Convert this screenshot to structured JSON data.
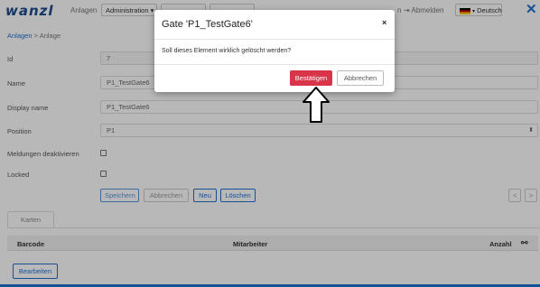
{
  "nav": {
    "logo": "wanzl",
    "anlagen": "Anlagen",
    "administration": "Administration ▾",
    "hidden_items": [
      "Einstellungen",
      "Hilfe"
    ],
    "logout_icon": "logout-icon",
    "logout": "Abmelden",
    "language": "Deutsch",
    "user_partial": "n"
  },
  "breadcrumb": {
    "root": "Anlagen",
    "sep": ">",
    "current": "Anlage"
  },
  "form": {
    "id_label": "Id",
    "id_value": "7",
    "name_label": "Name",
    "name_value": "P1_TestGate6",
    "display_label": "Display name",
    "display_value": "P1_TestGate6",
    "position_label": "Position",
    "position_value": "P1",
    "meldungen_label": "Meldungen deaktivieren",
    "locked_label": "Locked"
  },
  "actions": {
    "save": "Speichern",
    "cancel": "Abbrechen",
    "new": "Neu",
    "delete": "Löschen",
    "prev": "<",
    "next": ">"
  },
  "tabs": {
    "karten": "Karten"
  },
  "table": {
    "headers": [
      "Barcode",
      "Mitarbeiter",
      "Anzahl"
    ],
    "edit": "Bearbeiten"
  },
  "modal": {
    "title": "Gate 'P1_TestGate6'",
    "close": "×",
    "message": "Soll dieses Element wirklich gelöscht werden?",
    "confirm": "Bestätigen",
    "cancel": "Abbrechen"
  },
  "colors": {
    "brand": "#1b4b8f",
    "primary": "#1f6fd1",
    "danger": "#d9354a"
  }
}
